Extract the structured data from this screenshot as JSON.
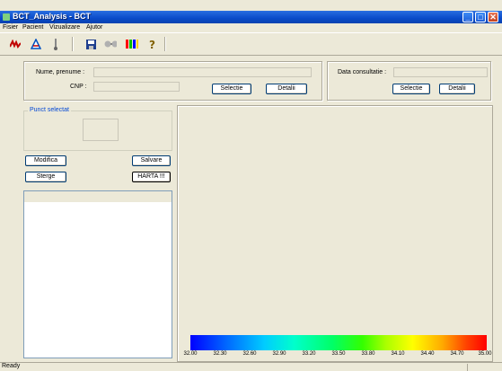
{
  "window": {
    "title": "BCT_Analysis - BCT"
  },
  "menu": {
    "items": [
      "Fisier",
      "Pacient",
      "Vizualizare",
      "Ajutor"
    ]
  },
  "toolbar": {
    "icons": [
      "graph-icon",
      "triangle-chart-icon",
      "thermometer-icon",
      "save-icon",
      "glasses-icon",
      "color-bars-icon",
      "help-icon"
    ]
  },
  "patient": {
    "name_label": "Nume, prenume :",
    "name_value": "",
    "cnp_label": "CNP :",
    "cnp_value": "",
    "select_label": "Selectie",
    "details_label": "Detalii"
  },
  "consultation": {
    "date_label": "Data consultatie :",
    "date_value": "",
    "select_label": "Selectie",
    "details_label": "Detalii"
  },
  "point": {
    "group_title": "Punct selectat",
    "value": ""
  },
  "actions": {
    "modify_label": "Modifica",
    "save_label": "Salvare",
    "delete_label": "Sterge",
    "map_label": "HARTA !!!"
  },
  "colorbar": {
    "ticks": [
      "32.00",
      "32.30",
      "32.60",
      "32.90",
      "33.20",
      "33.50",
      "33.80",
      "34.10",
      "34.40",
      "34.70",
      "35.00"
    ],
    "colors": [
      "#0000ff",
      "#00ccff",
      "#00ff66",
      "#ffff00",
      "#ff0000"
    ]
  },
  "status": {
    "text": "Ready"
  }
}
